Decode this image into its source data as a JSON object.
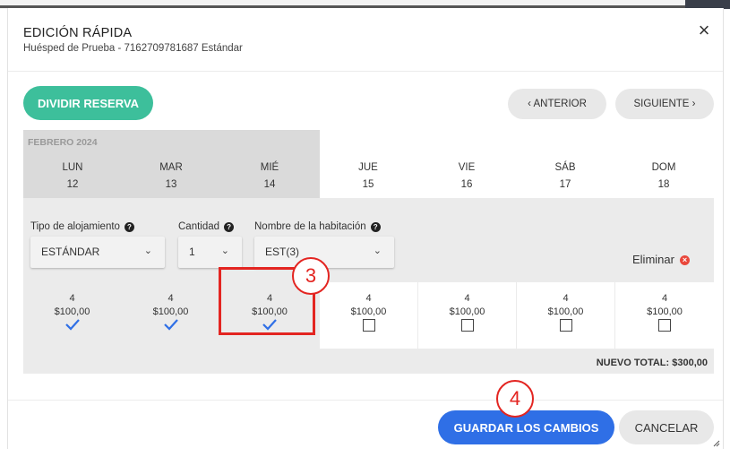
{
  "header": {
    "title": "EDICIÓN RÁPIDA",
    "subtitle": "Huésped de Prueba - 7162709781687 Estándar"
  },
  "actions": {
    "split_label": "DIVIDIR RESERVA",
    "prev_label": "‹ ANTERIOR",
    "next_label": "SIGUIENTE ›",
    "save_label": "GUARDAR LOS CAMBIOS",
    "cancel_label": "CANCELAR"
  },
  "calendar": {
    "month": "FEBRERO 2024",
    "days": [
      {
        "dow": "LUN",
        "num": "12"
      },
      {
        "dow": "MAR",
        "num": "13"
      },
      {
        "dow": "MIÉ",
        "num": "14"
      },
      {
        "dow": "JUE",
        "num": "15"
      },
      {
        "dow": "VIE",
        "num": "16"
      },
      {
        "dow": "SÁB",
        "num": "17"
      },
      {
        "dow": "DOM",
        "num": "18"
      }
    ]
  },
  "fields": {
    "type_label": "Tipo de alojamiento",
    "type_value": "ESTÁNDAR",
    "qty_label": "Cantidad",
    "qty_value": "1",
    "room_label": "Nombre de la habitación",
    "room_value": "EST(3)",
    "remove_label": "Eliminar"
  },
  "cells": [
    {
      "qty": "4",
      "price": "$100,00",
      "checked": true
    },
    {
      "qty": "4",
      "price": "$100,00",
      "checked": true
    },
    {
      "qty": "4",
      "price": "$100,00",
      "checked": true
    },
    {
      "qty": "4",
      "price": "$100,00",
      "checked": false
    },
    {
      "qty": "4",
      "price": "$100,00",
      "checked": false
    },
    {
      "qty": "4",
      "price": "$100,00",
      "checked": false
    },
    {
      "qty": "4",
      "price": "$100,00",
      "checked": false
    }
  ],
  "total": "NUEVO TOTAL: $300,00",
  "annotations": {
    "step3": "3",
    "step4": "4"
  },
  "colors": {
    "split_button": "#3dbf9b",
    "save_button": "#2f6fe6",
    "check": "#2f6fe6",
    "annotation": "#e32521",
    "remove_icon": "#e9473b"
  }
}
